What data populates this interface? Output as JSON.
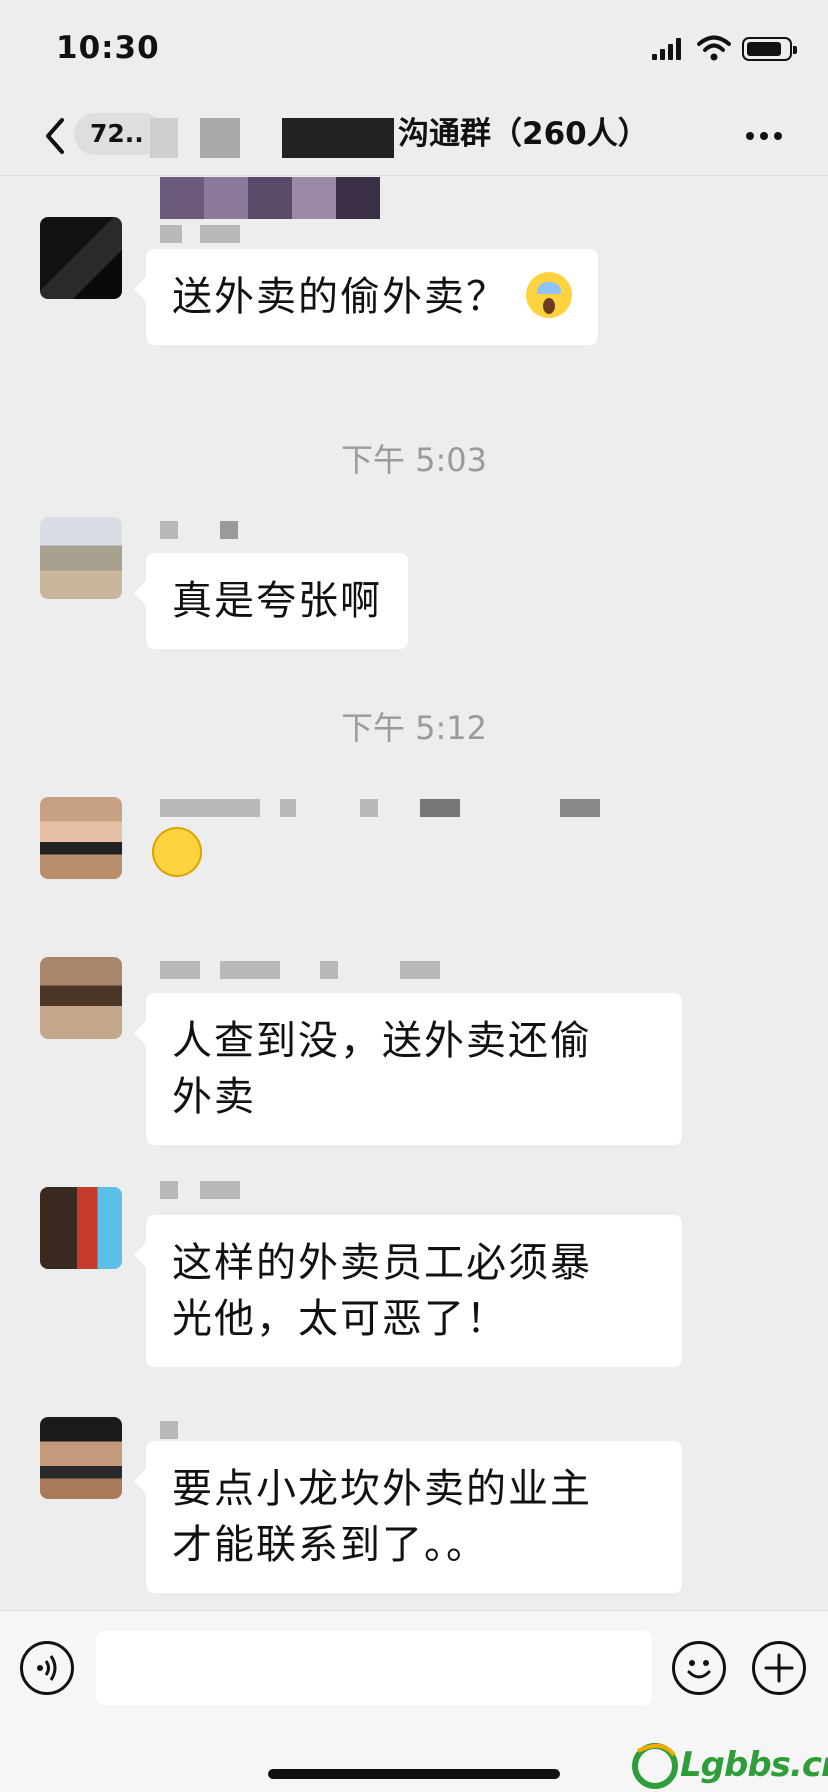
{
  "status_bar": {
    "time": "10:30"
  },
  "nav": {
    "badge": "72..",
    "title": "沟通群（260人）"
  },
  "messages": [
    {
      "text": "送外卖的偷外卖？",
      "emoji": "scream-emoji"
    },
    {
      "timestamp": "下午 5:03"
    },
    {
      "text": "真是夸张啊"
    },
    {
      "timestamp": "下午 5:12"
    },
    {
      "emoji": "thinking-emoji"
    },
    {
      "lines": [
        "人查到没，送外卖还偷",
        "外卖"
      ]
    },
    {
      "lines": [
        "这样的外卖员工必须暴",
        "光他，太可恶了！"
      ]
    },
    {
      "lines": [
        "要点小龙坎外卖的业主",
        "才能联系到了。。"
      ]
    }
  ],
  "input_bar": {
    "placeholder": ""
  },
  "watermark": {
    "text": "Lgbbs.cn"
  },
  "colors": {
    "background": "#ededed",
    "bubble": "#ffffff",
    "timestamp": "#9a9a9a",
    "watermark": "#2e9d3a"
  }
}
